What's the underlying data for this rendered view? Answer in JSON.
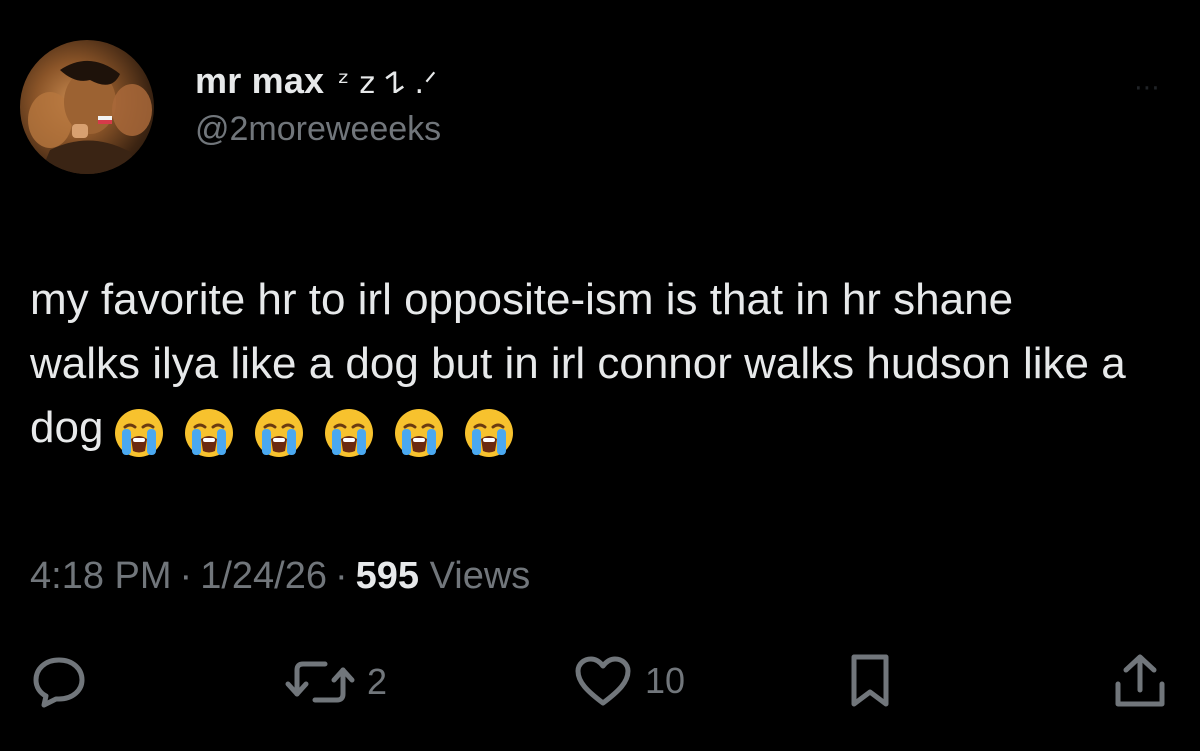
{
  "author": {
    "display_name": "mr max",
    "name_suffix": "ᶻ z 𐰁 .ᐟ",
    "handle": "@2moreweeeks"
  },
  "tweet": {
    "text": "my favorite hr to irl opposite-ism is that in hr shane walks ilya like a dog but in irl connor walks hudson like a dog",
    "emojis": [
      "loudly-crying-face",
      "loudly-crying-face",
      "loudly-crying-face",
      "loudly-crying-face",
      "loudly-crying-face",
      "loudly-crying-face"
    ]
  },
  "meta": {
    "time": "4:18 PM",
    "separator": "·",
    "date": "1/24/26",
    "views_count": "595",
    "views_label": "Views"
  },
  "actions": {
    "reply": {
      "icon": "reply-icon"
    },
    "retweet": {
      "icon": "retweet-icon",
      "count": "2"
    },
    "like": {
      "icon": "heart-icon",
      "count": "10"
    },
    "bookmark": {
      "icon": "bookmark-icon"
    },
    "share": {
      "icon": "share-icon"
    }
  },
  "colors": {
    "background": "#000000",
    "text_primary": "#e7e9ea",
    "text_secondary": "#71767b"
  }
}
